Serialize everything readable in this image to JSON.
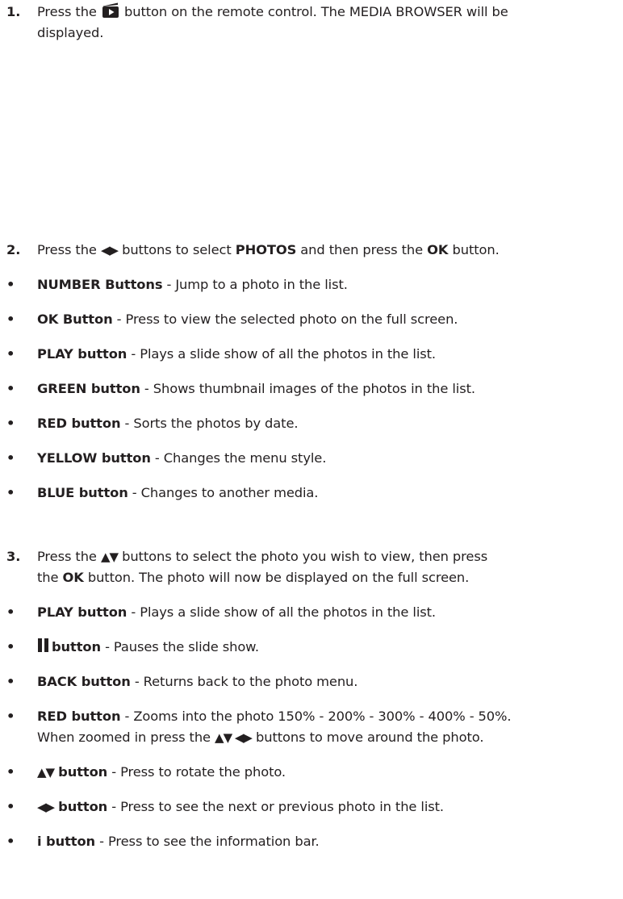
{
  "steps": [
    {
      "number": "1.",
      "before": "Press the",
      "icon": "media-browser-icon",
      "after": "button on the remote control. The MEDIA BROWSER will be",
      "line2": "displayed."
    },
    {
      "number": "2.",
      "before": "Press the",
      "arrows": "◀▶",
      "middle": "buttons to select",
      "strong1": "PHOTOS",
      "middle2": "and then press the",
      "strong2": "OK",
      "after": "button."
    },
    {
      "number": "3.",
      "before": "Press the",
      "arrows": "▲▼",
      "after": "buttons to select the photo you wish to view, then press",
      "line2_before": "the",
      "line2_strong": "OK",
      "line2_after": "button. The photo will now be displayed on the full screen."
    }
  ],
  "list_controls": [
    {
      "label": "NUMBER Buttons",
      "desc": "- Jump to a photo in the list."
    },
    {
      "label": "OK Button",
      "desc": "- Press to view the selected photo on the full screen."
    },
    {
      "label": "PLAY button",
      "desc": "- Plays a slide show of all the photos in the list."
    },
    {
      "label": "GREEN button",
      "desc": "- Shows thumbnail images of the photos in the list."
    },
    {
      "label": "RED button",
      "desc": "- Sorts the photos by date."
    },
    {
      "label": "YELLOW button",
      "desc": "- Changes the menu style."
    },
    {
      "label": "BLUE button",
      "desc": "- Changes to another media."
    }
  ],
  "view_controls": {
    "play": {
      "label": "PLAY button",
      "desc": "- Plays a slide show of all the photos in the list."
    },
    "pause": {
      "icon": "pause-icon",
      "label": "button",
      "desc": "- Pauses the slide show."
    },
    "back": {
      "label": "BACK button",
      "desc": "- Returns back to the photo menu."
    },
    "red": {
      "label": "RED button",
      "desc": "- Zooms into the photo 150% - 200% - 300% - 400% - 50%.",
      "line2_before": "When zoomed in press the",
      "line2_arrows": "▲▼ ◀▶",
      "line2_after": "buttons to move around the photo."
    },
    "rotate": {
      "arrows": "▲▼",
      "label": "button",
      "desc": "- Press to rotate the photo."
    },
    "nextprev": {
      "arrows": "◀▶",
      "label": "button",
      "desc": "- Press to see the next or previous photo in the list."
    },
    "info": {
      "label": "i button",
      "desc": "- Press to see the information bar."
    }
  },
  "bullet_char": "•"
}
